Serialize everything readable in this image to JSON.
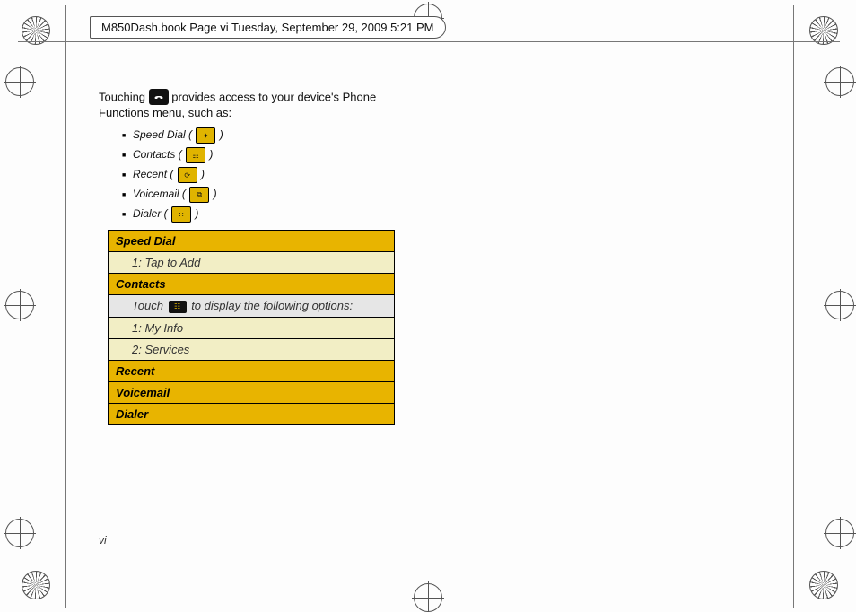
{
  "header": {
    "path_text": "M850Dash.book  Page vi  Tuesday, September 29, 2009  5:21 PM"
  },
  "intro": {
    "prefix": "Touching ",
    "suffix": " provides access to your device's Phone Functions menu, such as:",
    "phone_glyph": "⌕"
  },
  "funcs": [
    {
      "label": "Speed Dial",
      "icon": "speed-dial-icon"
    },
    {
      "label": "Contacts",
      "icon": "contacts-icon"
    },
    {
      "label": "Recent",
      "icon": "recent-icon"
    },
    {
      "label": "Voicemail",
      "icon": "voicemail-icon"
    },
    {
      "label": "Dialer",
      "icon": "dialer-icon"
    }
  ],
  "table": {
    "speed_dial": "Speed Dial",
    "tap_to_add": "1: Tap to Add",
    "contacts": "Contacts",
    "note_prefix": "Touch ",
    "note_suffix": " to display the following options:",
    "my_info": "1: My Info",
    "services": "2: Services",
    "recent": "Recent",
    "voicemail": "Voicemail",
    "dialer": "Dialer"
  },
  "folio": "vi"
}
